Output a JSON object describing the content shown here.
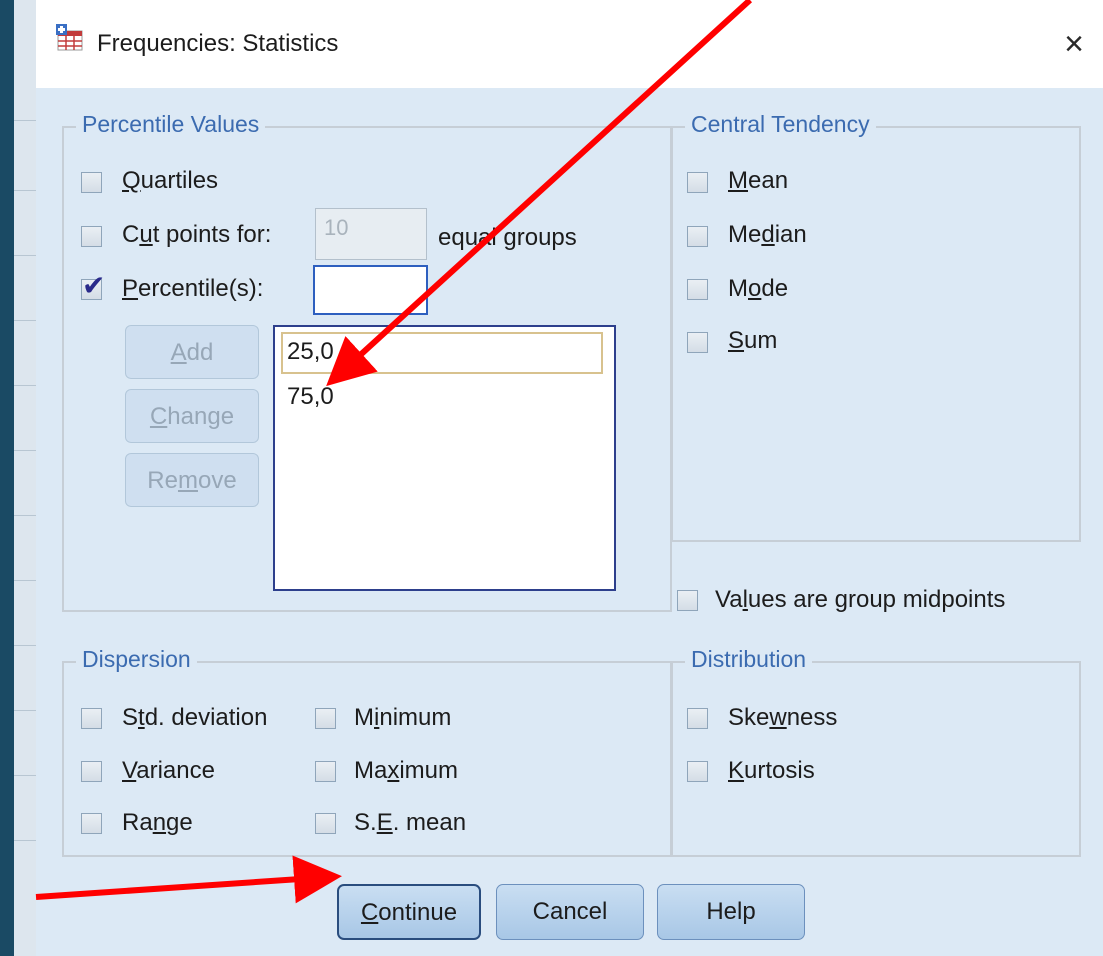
{
  "window": {
    "title": "Frequencies: Statistics",
    "close_icon": "×"
  },
  "percentile_values": {
    "group_title": "Percentile Values",
    "quartiles_label": {
      "pre": "",
      "u": "Q",
      "post": "uartiles"
    },
    "quartiles_checked": false,
    "cut_points_label": {
      "pre": "C",
      "u": "u",
      "post": "t points for:"
    },
    "cut_points_checked": false,
    "cut_points_value": "10",
    "equal_groups_label": "equal groups",
    "percentiles_label": {
      "pre": "",
      "u": "P",
      "post": "ercentile(s):"
    },
    "percentiles_checked": true,
    "percentile_input_value": "",
    "add_button": {
      "pre": "",
      "u": "A",
      "post": "dd"
    },
    "change_button": {
      "pre": "",
      "u": "C",
      "post": "hange"
    },
    "remove_button": {
      "pre": "Re",
      "u": "m",
      "post": "ove"
    },
    "percentile_list": [
      "25,0",
      "75,0"
    ]
  },
  "central_tendency": {
    "group_title": "Central Tendency",
    "items": [
      {
        "pre": "",
        "u": "M",
        "post": "ean",
        "checked": false
      },
      {
        "pre": "Me",
        "u": "d",
        "post": "ian",
        "checked": false
      },
      {
        "pre": "M",
        "u": "o",
        "post": "de",
        "checked": false
      },
      {
        "pre": "",
        "u": "S",
        "post": "um",
        "checked": false
      }
    ]
  },
  "group_midpoints": {
    "pre": "Va",
    "u": "l",
    "post": "ues are group midpoints",
    "checked": false
  },
  "dispersion": {
    "group_title": "Dispersion",
    "items": [
      {
        "pre": "S",
        "u": "t",
        "post": "d. deviation",
        "checked": false
      },
      {
        "pre": "M",
        "u": "i",
        "post": "nimum",
        "checked": false
      },
      {
        "pre": "",
        "u": "V",
        "post": "ariance",
        "checked": false
      },
      {
        "pre": "Ma",
        "u": "x",
        "post": "imum",
        "checked": false
      },
      {
        "pre": "Ra",
        "u": "n",
        "post": "ge",
        "checked": false
      },
      {
        "pre": "S.",
        "u": "E",
        "post": ". mean",
        "checked": false
      }
    ]
  },
  "distribution": {
    "group_title": "Distribution",
    "items": [
      {
        "pre": "Ske",
        "u": "w",
        "post": "ness",
        "checked": false
      },
      {
        "pre": "",
        "u": "K",
        "post": "urtosis",
        "checked": false
      }
    ]
  },
  "buttons": {
    "continue": {
      "pre": "",
      "u": "C",
      "post": "ontinue"
    },
    "cancel": "Cancel",
    "help": "Help"
  },
  "colors": {
    "group_title": "#3b6bb0",
    "dialog_bg": "#dce9f5",
    "annotation_arrow": "#ff0000",
    "backdrop": "#17435c"
  },
  "annotations": [
    "red-arrow-to-percentile-list",
    "red-arrow-to-continue-button"
  ]
}
